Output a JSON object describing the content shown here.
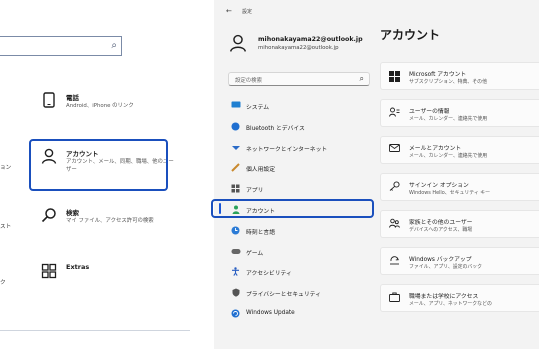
{
  "left_panel": {
    "items": [
      {
        "icon": "phone-icon",
        "title": "電話",
        "desc": "Android、iPhone のリンク"
      },
      {
        "icon": "person-icon",
        "title": "アカウント",
        "desc": "アカウント、メール、同期、職場、他のユーザー"
      },
      {
        "icon": "search-icon",
        "title": "検索",
        "desc": "マイ ファイル、アクセス許可の検索"
      },
      {
        "icon": "extras-icon",
        "title": "Extras",
        "desc": ""
      }
    ],
    "fragments": [
      "ョン",
      "スト",
      "ク"
    ]
  },
  "window": {
    "back_label": "←",
    "app_title": "設定",
    "account": {
      "email": "mihonakayama22@outlook.jp",
      "subtitle": "mihonakayama22@outlook.jp"
    },
    "search": {
      "placeholder": "設定の検索"
    },
    "nav": [
      {
        "icon": "system-icon",
        "label": "システム",
        "color": "#1f7fd1"
      },
      {
        "icon": "bluetooth-icon",
        "label": "Bluetooth とデバイス",
        "color": "#1f6fd1"
      },
      {
        "icon": "network-icon",
        "label": "ネットワークとインターネット",
        "color": "#2b6bc7"
      },
      {
        "icon": "personalize-icon",
        "label": "個人用設定",
        "color": "#c9892e"
      },
      {
        "icon": "apps-icon",
        "label": "アプリ",
        "color": "#555555"
      },
      {
        "icon": "account-icon",
        "label": "アカウント",
        "color": "#2aa15b"
      },
      {
        "icon": "time-language-icon",
        "label": "時刻と言語",
        "color": "#2b7bd6"
      },
      {
        "icon": "gaming-icon",
        "label": "ゲーム",
        "color": "#666666"
      },
      {
        "icon": "accessibility-icon",
        "label": "アクセシビリティ",
        "color": "#2a5fc2"
      },
      {
        "icon": "privacy-icon",
        "label": "プライバシーとセキュリティ",
        "color": "#555555"
      },
      {
        "icon": "windows-update-icon",
        "label": "Windows Update",
        "color": "#1f6fd1"
      }
    ],
    "page_title": "アカウント",
    "cards": [
      {
        "icon": "microsoft-logo-icon",
        "title": "Microsoft アカウント",
        "desc": "サブスクリプション、特典、その他"
      },
      {
        "icon": "user-info-icon",
        "title": "ユーザーの情報",
        "desc": "メール、カレンダー、連絡先で使用"
      },
      {
        "icon": "mail-icon",
        "title": "メールとアカウント",
        "desc": "メール、カレンダー、連絡先で使用"
      },
      {
        "icon": "key-icon",
        "title": "サインイン オプション",
        "desc": "Windows Hello、セキュリティ キー"
      },
      {
        "icon": "family-icon",
        "title": "家族とその他のユーザー",
        "desc": "デバイスへのアクセス、職場"
      },
      {
        "icon": "backup-icon",
        "title": "Windows バックアップ",
        "desc": "ファイル、アプリ、設定のバック"
      },
      {
        "icon": "briefcase-icon",
        "title": "職場または学校にアクセス",
        "desc": "メール、アプリ、ネットワークなどの"
      }
    ]
  }
}
